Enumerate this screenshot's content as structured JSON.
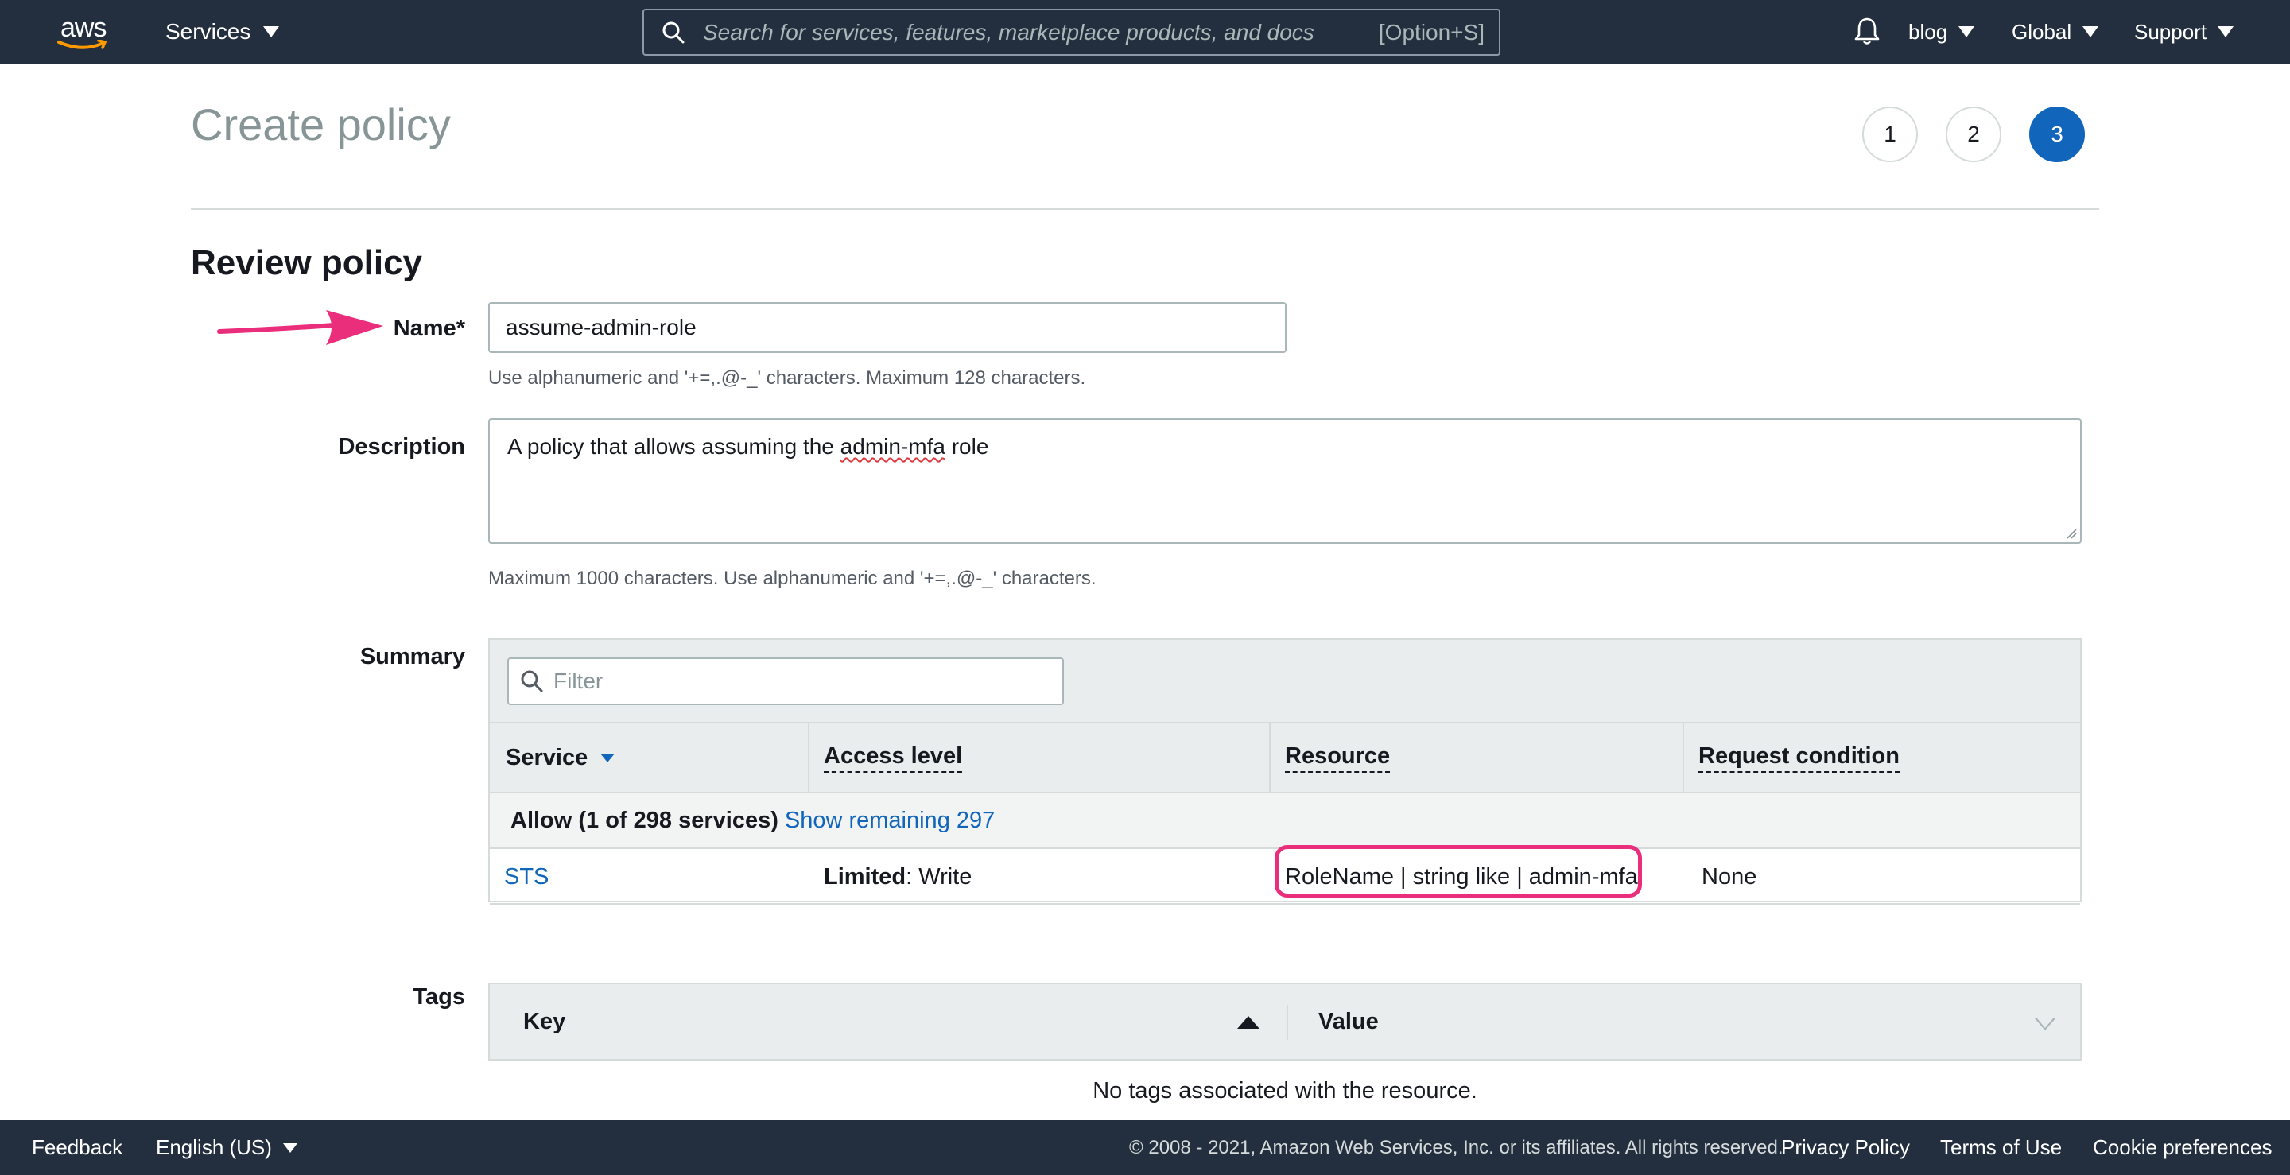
{
  "topnav": {
    "logo_text": "aws",
    "services_label": "Services",
    "search_placeholder": "Search for services, features, marketplace products, and docs",
    "search_shortcut": "[Option+S]",
    "account_label": "blog",
    "region_label": "Global",
    "support_label": "Support",
    "icons": [
      "bell-icon",
      "search-icon",
      "caret-down-icon"
    ]
  },
  "page": {
    "title": "Create policy",
    "steps": [
      "1",
      "2",
      "3"
    ],
    "active_step": "3",
    "section_title": "Review policy"
  },
  "form": {
    "name_label": "Name*",
    "name_value": "assume-admin-role",
    "name_hint": "Use alphanumeric and '+=,.@-_' characters. Maximum 128 characters.",
    "description_label": "Description",
    "description_prefix": "A policy that allows assuming the ",
    "description_squiggle": "admin-mfa",
    "description_suffix": " role",
    "description_hint": "Maximum 1000 characters. Use alphanumeric and '+=,.@-_' characters."
  },
  "summary": {
    "label": "Summary",
    "filter_placeholder": "Filter",
    "columns": [
      "Service",
      "Access level",
      "Resource",
      "Request condition"
    ],
    "allow_text": "Allow (1 of 298 services)",
    "show_remaining": "Show remaining 297",
    "rows": [
      {
        "service": "STS",
        "access_bold": "Limited",
        "access_rest": ": Write",
        "resource": "RoleName | string like | admin-mfa",
        "condition": "None"
      }
    ]
  },
  "tags": {
    "label": "Tags",
    "key_header": "Key",
    "value_header": "Value",
    "empty_text": "No tags associated with the resource."
  },
  "footer": {
    "feedback": "Feedback",
    "language": "English (US)",
    "copyright": "© 2008 - 2021, Amazon Web Services, Inc. or its affiliates. All rights reserved.",
    "privacy": "Privacy Policy",
    "terms": "Terms of Use",
    "cookies": "Cookie preferences"
  },
  "colors": {
    "nav_bg": "#232f3e",
    "link": "#1166bb",
    "active_step": "#1166bb",
    "annotation": "#ea2e7b"
  }
}
